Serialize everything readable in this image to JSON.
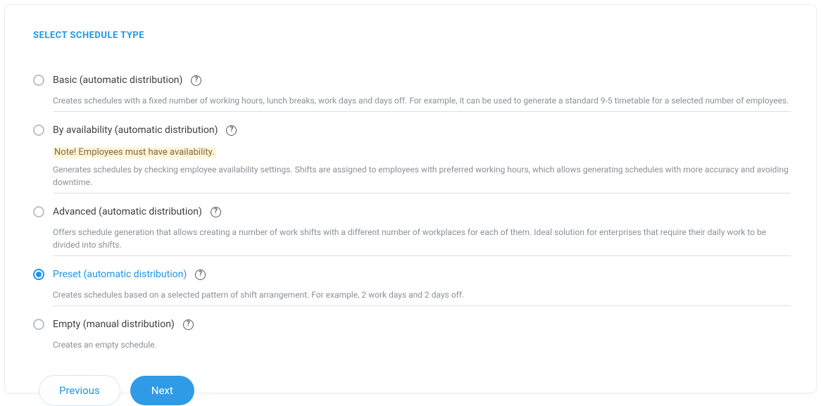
{
  "heading": "SELECT SCHEDULE TYPE",
  "options": [
    {
      "id": "basic",
      "label": "Basic (automatic distribution)",
      "note": null,
      "desc": "Creates schedules with a fixed number of working hours, lunch breaks, work days and days off. For example, it can be used to generate a standard 9-5 timetable for a selected number of employees.",
      "selected": false,
      "bordered": true
    },
    {
      "id": "availability",
      "label": "By availability (automatic distribution)",
      "note": "Note! Employees must have availability.",
      "desc": "Generates schedules by checking employee availability settings. Shifts are assigned to employees with preferred working hours, which allows generating schedules with more accuracy and avoiding downtime.",
      "selected": false,
      "bordered": true
    },
    {
      "id": "advanced",
      "label": "Advanced (automatic distribution)",
      "note": null,
      "desc": "Offers schedule generation that allows creating a number of work shifts with a different number of workplaces for each of them. Ideal solution for enterprises that require their daily work to be divided into shifts.",
      "selected": false,
      "bordered": true
    },
    {
      "id": "preset",
      "label": "Preset (automatic distribution)",
      "note": null,
      "desc": "Creates schedules based on a selected pattern of shift arrangement. For example, 2 work days and 2 days off.",
      "selected": true,
      "bordered": true
    },
    {
      "id": "empty",
      "label": "Empty (manual distribution)",
      "note": null,
      "desc": "Creates an empty schedule.",
      "selected": false,
      "bordered": false
    }
  ],
  "buttons": {
    "previous": "Previous",
    "next": "Next"
  },
  "helpGlyph": "?"
}
